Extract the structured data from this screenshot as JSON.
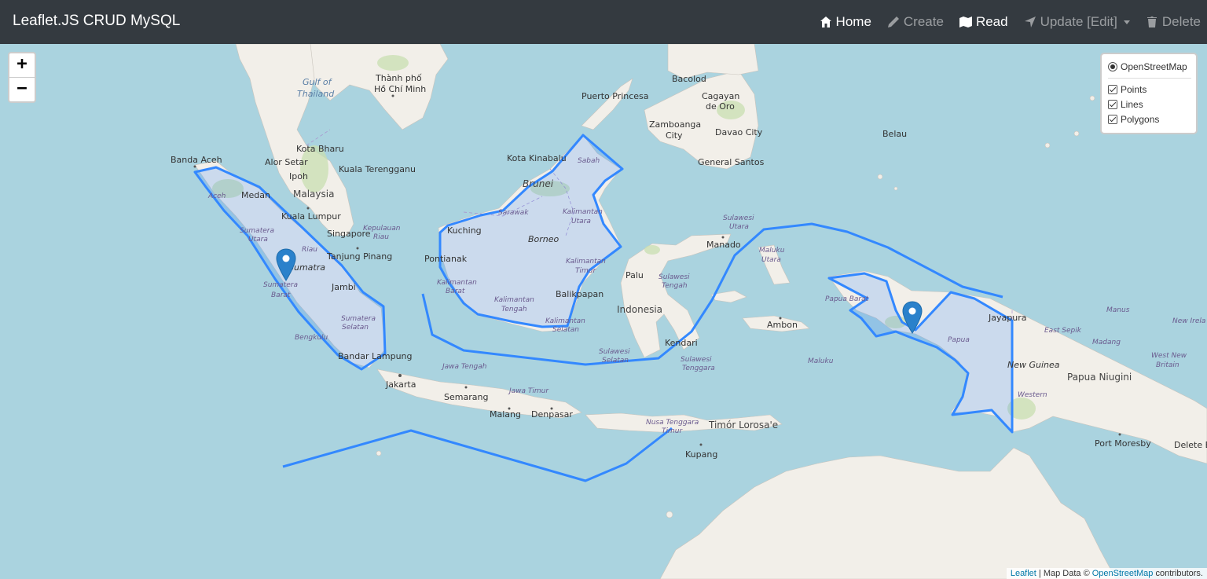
{
  "navbar": {
    "brand": "Leaflet.JS CRUD MySQL",
    "items": [
      {
        "label": "Home",
        "icon": "home-icon",
        "active": true
      },
      {
        "label": "Create",
        "icon": "pencil-icon",
        "active": false
      },
      {
        "label": "Read",
        "icon": "map-icon",
        "active": true
      },
      {
        "label": "Update [Edit]",
        "icon": "location-arrow-icon",
        "active": false,
        "dropdown": true
      },
      {
        "label": "Delete",
        "icon": "trash-icon",
        "active": false
      }
    ]
  },
  "zoom": {
    "in": "+",
    "out": "−"
  },
  "layers": {
    "base": "OpenStreetMap",
    "overlays": [
      "Points",
      "Lines",
      "Polygons"
    ]
  },
  "attribution": {
    "leaflet": "Leaflet",
    "sep": " | Map Data © ",
    "osm": "OpenStreetMap",
    "suffix": " contributors."
  },
  "map_labels": {
    "thanh_pho_ho_chi_minh_1": "Thành phố",
    "thanh_pho_ho_chi_minh_2": "Hồ Chí Minh",
    "gulf_of_thailand_1": "Gulf of",
    "gulf_of_thailand_2": "Thailand",
    "banda_aceh": "Banda Aceh",
    "kota_bharu": "Kota Bharu",
    "alor_setar": "Alor Setar",
    "kuala_terengganu": "Kuala Terengganu",
    "ipoh": "Ipoh",
    "medan": "Medan",
    "malaysia": "Malaysia",
    "kuala_lumpur": "Kuala Lumpur",
    "singapore": "Singapore",
    "tanjung_pinang": "Tanjung Pinang",
    "sumatra": "Sumatra",
    "jambi": "Jambi",
    "bandar_lampung": "Bandar Lampung",
    "jakarta": "Jakarta",
    "semarang": "Semarang",
    "malang": "Malang",
    "denpasar": "Denpasar",
    "kupang": "Kupang",
    "timor_leste": "Timór Lorosa'e",
    "puerto_princesa": "Puerto Princesa",
    "bacolod": "Bacolod",
    "cagayan_1": "Cagayan",
    "cagayan_2": "de Oro",
    "zamboanga_1": "Zamboanga",
    "zamboanga_2": "City",
    "davao": "Davao City",
    "general_santos": "General Santos",
    "kota_kinabalu": "Kota Kinabalu",
    "brunei": "Brunei",
    "kuching": "Kuching",
    "pontianak": "Pontianak",
    "borneo": "Borneo",
    "balikpapan": "Balikpapan",
    "palu": "Palu",
    "manado": "Manado",
    "indonesia": "Indonesia",
    "kendari": "Kendari",
    "ambon": "Ambon",
    "belau": "Belau",
    "jayapura": "Jayapura",
    "new_guinea": "New Guinea",
    "papua_niugini": "Papua Niugini",
    "port_moresby": "Port Moresby",
    "sabah": "Sabah",
    "sarawak": "Sarawak",
    "kal_utara_1": "Kalimantan",
    "kal_utara_2": "Utara",
    "kal_timur_1": "Kalimantan",
    "kal_timur_2": "Timur",
    "kal_barat_1": "Kalimantan",
    "kal_barat_2": "Barat",
    "kal_tengah_1": "Kalimantan",
    "kal_tengah_2": "Tengah",
    "kal_selatan_1": "Kalimantan",
    "kal_selatan_2": "Selatan",
    "kepulauan_riau_1": "Kepulauan",
    "kepulauan_riau_2": "Riau",
    "aceh": "Aceh",
    "sumatera_utara_1": "Sumatera",
    "sumatera_utara_2": "Utara",
    "riau": "Riau",
    "sumatera_barat_1": "Sumatera",
    "sumatera_barat_2": "Barat",
    "sumatera_selatan_1": "Sumatera",
    "sumatera_selatan_2": "Selatan",
    "bengkulu": "Bengkulu",
    "jawa_tengah": "Jawa Tengah",
    "jawa_timur": "Jawa Timur",
    "nusa_tenggara_1": "Nusa Tenggara",
    "nusa_tenggara_2": "Timur",
    "sulawesi_utara_1": "Sulawesi",
    "sulawesi_utara_2": "Utara",
    "sulawesi_tengah_1": "Sulawesi",
    "sulawesi_tengah_2": "Tengah",
    "sulawesi_selatan_1": "Sulawesi",
    "sulawesi_selatan_2": "Selatan",
    "sulawesi_tenggara_1": "Sulawesi",
    "sulawesi_tenggara_2": "Tenggara",
    "maluku_utara_1": "Maluku",
    "maluku_utara_2": "Utara",
    "maluku": "Maluku",
    "papua_barat": "Papua Barat",
    "papua": "Papua",
    "east_sepik": "East Sepik",
    "madang": "Madang",
    "manus": "Manus",
    "new_ireland": "New Irela",
    "west_new_britain_1": "West New",
    "west_new_britain_2": "Britain",
    "western": "Western",
    "delete_ba": "Delete Ba"
  },
  "colors": {
    "water": "#aad3df",
    "land": "#f2efe9",
    "green": "#c8dfb0",
    "overlay": "#3388ff",
    "marker": "#2a81cb"
  }
}
